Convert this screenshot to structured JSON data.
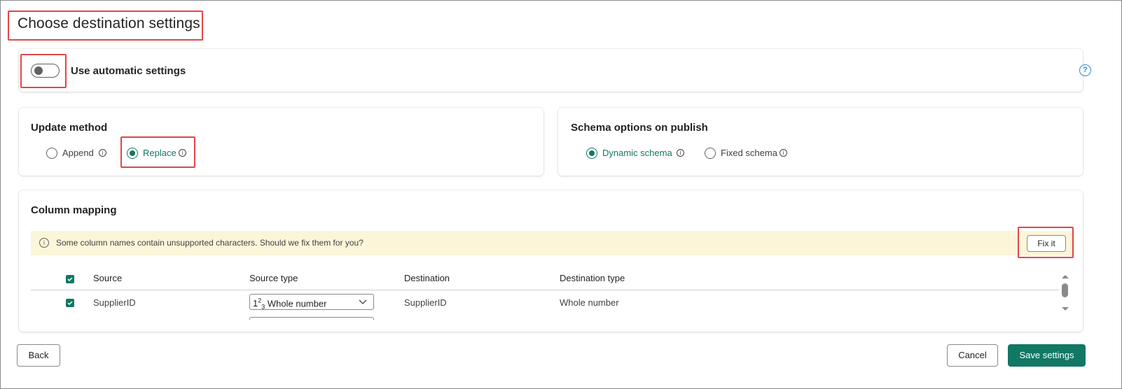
{
  "title": "Choose destination settings",
  "auto_settings": {
    "label": "Use automatic settings",
    "enabled": false
  },
  "update_method": {
    "title": "Update method",
    "options": [
      {
        "label": "Append",
        "selected": false
      },
      {
        "label": "Replace",
        "selected": true
      }
    ]
  },
  "schema_options": {
    "title": "Schema options on publish",
    "options": [
      {
        "label": "Dynamic schema",
        "selected": true
      },
      {
        "label": "Fixed schema",
        "selected": false
      }
    ]
  },
  "column_mapping": {
    "title": "Column mapping",
    "banner": {
      "text": "Some column names contain unsupported characters. Should we fix them for you?",
      "fix_label": "Fix it"
    },
    "headers": [
      "Source",
      "Source type",
      "Destination",
      "Destination type"
    ],
    "rows": [
      {
        "checked": true,
        "source": "SupplierID",
        "source_type_prefix": "1",
        "source_type_sup": "2",
        "source_type_sub": "3",
        "source_type": "Whole number",
        "destination": "SupplierID",
        "destination_type": "Whole number"
      }
    ]
  },
  "footer": {
    "back": "Back",
    "cancel": "Cancel",
    "save": "Save settings"
  },
  "colors": {
    "accent": "#117865",
    "highlight": "#e0464b",
    "banner_bg": "#fbf6d9",
    "help": "#2b88d8"
  }
}
